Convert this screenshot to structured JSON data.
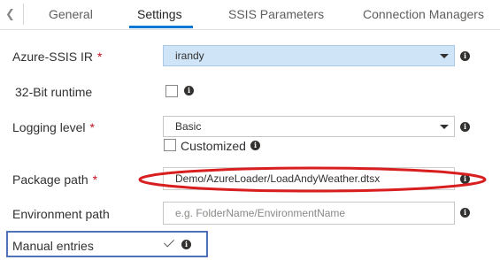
{
  "tabs": [
    {
      "label": "General",
      "active": false
    },
    {
      "label": "Settings",
      "active": true
    },
    {
      "label": "SSIS Parameters",
      "active": false
    },
    {
      "label": "Connection Managers",
      "active": false
    }
  ],
  "form": {
    "required_mark": "*",
    "azure_ir": {
      "label": "Azure-SSIS IR",
      "value": "irandy"
    },
    "runtime_32bit": {
      "label": "32-Bit runtime",
      "checked": false
    },
    "logging_level": {
      "label": "Logging level",
      "value": "Basic",
      "customized_label": "Customized",
      "customized_checked": false
    },
    "package_path": {
      "label": "Package path",
      "value": "Demo/AzureLoader/LoadAndyWeather.dtsx"
    },
    "environment_path": {
      "label": "Environment path",
      "value": "",
      "placeholder": "e.g. FolderName/EnvironmentName"
    },
    "manual_entries": {
      "label": "Manual entries",
      "checked": true
    }
  },
  "info_glyph": "i",
  "colors": {
    "accent": "#0078d4",
    "required": "#c50f1f",
    "highlight_ellipse": "#d81e1e",
    "highlight_frame": "#4f72b8",
    "ir_select_bg": "#cfe4f7"
  }
}
